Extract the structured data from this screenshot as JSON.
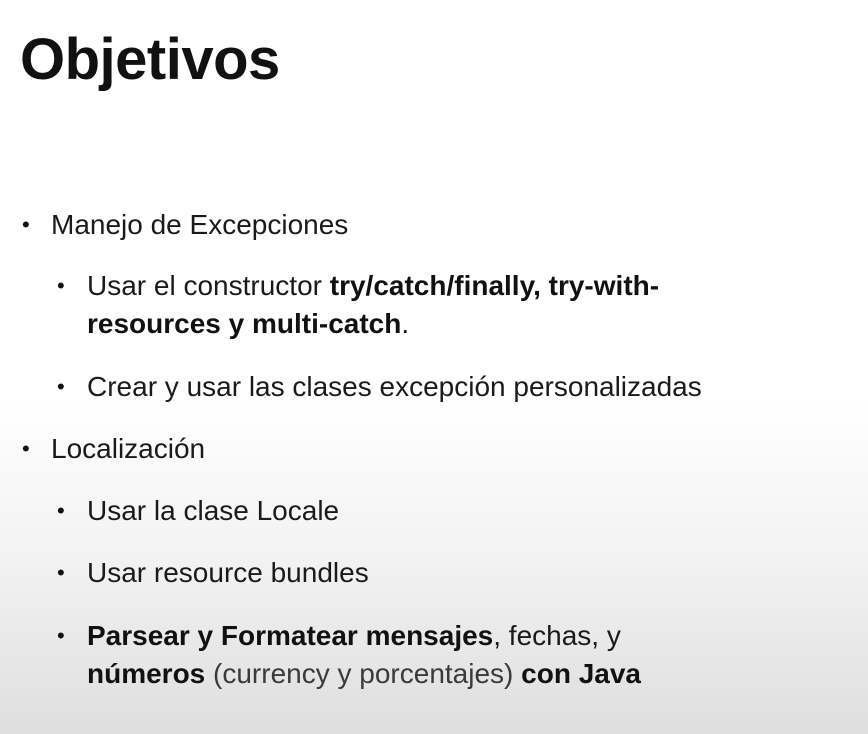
{
  "slide": {
    "title": "Objetivos",
    "bullets": [
      {
        "text": "Manejo de Excepciones",
        "children": [
          {
            "part1": "Usar el constructor ",
            "part2_bold": "try/catch/finally, try-with-",
            "part3_bold": "resources y multi-catch",
            "part4": "."
          },
          {
            "text": "Crear y usar las clases excepción personalizadas"
          }
        ]
      },
      {
        "text": "Localización",
        "children": [
          {
            "text": "Usar la clase Locale"
          },
          {
            "text": "Usar resource bundles"
          },
          {
            "part1_bold": "Parsear y Formatear mensajes",
            "part2": ", fechas, y",
            "part3_bold": "números",
            "part4_light": " (currency y porcentajes) ",
            "part5_bold": "con Java"
          }
        ]
      }
    ],
    "bullet_symbol": "•"
  }
}
